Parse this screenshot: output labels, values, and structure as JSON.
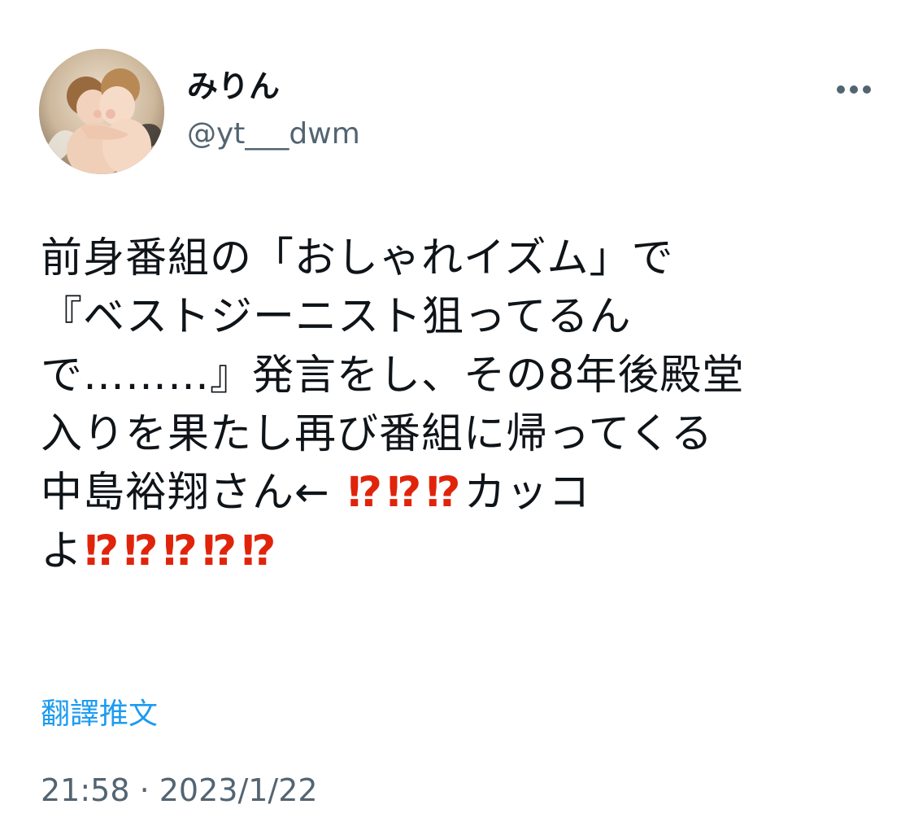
{
  "author": {
    "display_name": "みりん",
    "handle": "@yt___dwm",
    "avatar_icon": "avatar-painting-icon"
  },
  "menu": {
    "icon": "more-horizontal-icon"
  },
  "tweet": {
    "lines": [
      "前身番組の「おしゃれイズム」で",
      "『ベストジーニスト狙ってるん",
      "で………』発言をし、その8年後殿堂",
      "入りを果たし再び番組に帰ってくる"
    ],
    "line5_text": "中島裕翔さん←",
    "line5_emojis": [
      "⁉",
      "⁉",
      "⁉"
    ],
    "line5_suffix": "カッコ",
    "line6_prefix": "よ",
    "line6_emojis": [
      "⁉",
      "⁉",
      "⁉",
      "⁉",
      "⁉"
    ]
  },
  "translate_label": "翻譯推文",
  "timestamp": "21:58 · 2023/1/22",
  "colors": {
    "accent": "#1d9bf0",
    "secondary_text": "#536471",
    "emoji_red": "#e0240b",
    "primary_text": "#0f1419"
  }
}
